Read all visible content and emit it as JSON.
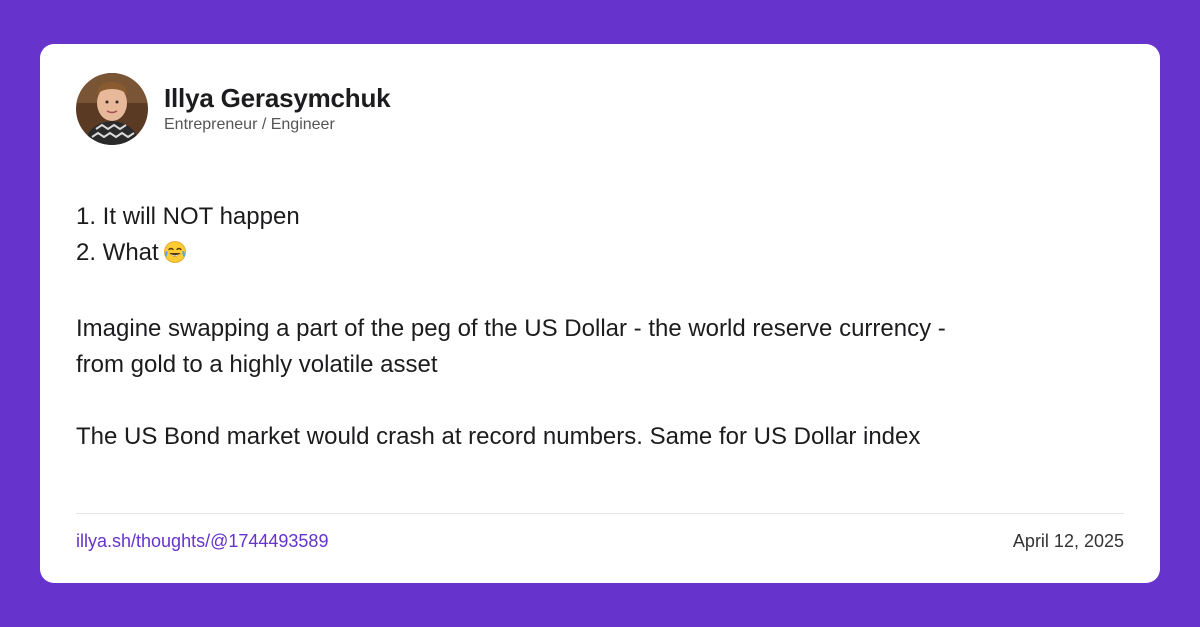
{
  "author": {
    "name": "Illya Gerasymchuk",
    "title": "Entrepreneur / Engineer"
  },
  "post": {
    "line1": "1. It will NOT happen",
    "line2": "2. What",
    "line2_emoji": "face-with-tears-of-joy-icon",
    "paragraph1_a": "Imagine swapping a part of the peg of the US Dollar - the world reserve currency -",
    "paragraph1_b": "from gold to a highly volatile asset",
    "paragraph2": "The US Bond market would crash at record numbers. Same for US Dollar index"
  },
  "footer": {
    "link": "illya.sh/thoughts/@1744493589",
    "date": "April 12, 2025"
  },
  "colors": {
    "background": "#6633cc",
    "card": "#ffffff",
    "link": "#6633cc"
  }
}
